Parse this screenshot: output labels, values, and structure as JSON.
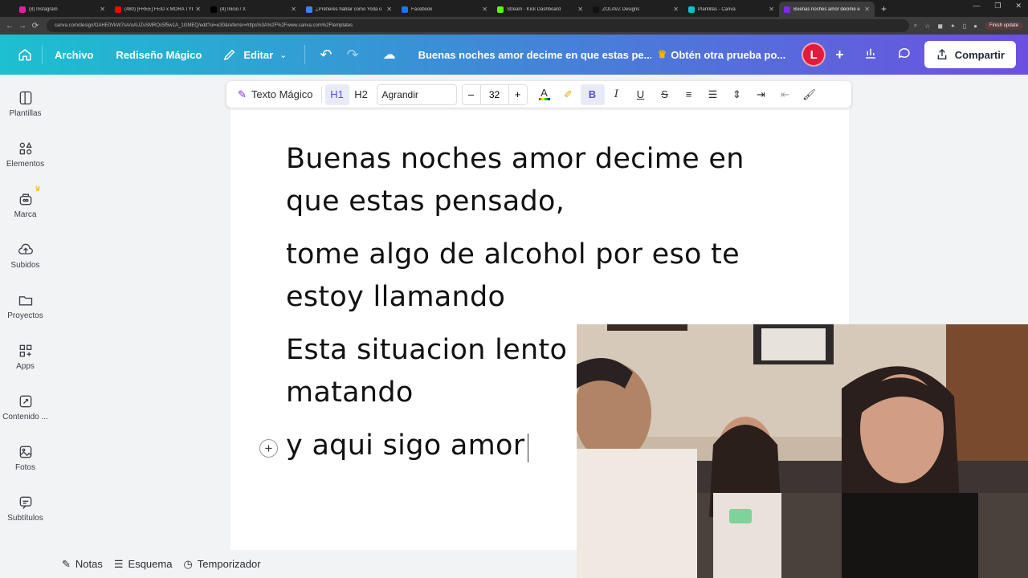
{
  "browser": {
    "tabs": [
      {
        "title": "(8) Instagram",
        "color": "#d6249f"
      },
      {
        "title": "(480) [FREE] FEID x MORA TYPE",
        "color": "#ff0000"
      },
      {
        "title": "(4) Inicio / X",
        "color": "#000000"
      },
      {
        "title": "¿Prefieres hablar como Yoda o",
        "color": "#3b82f6"
      },
      {
        "title": "Facebook",
        "color": "#1877f2"
      },
      {
        "title": "Stream - Kick Dashboard",
        "color": "#53fc18"
      },
      {
        "title": "ZOLAVZ Designs",
        "color": "#111111"
      },
      {
        "title": "Plantillas - Canva",
        "color": "#00c4cc"
      },
      {
        "title": "Buenas noches amor decime e",
        "color": "#7d2ae8",
        "active": true
      }
    ],
    "url": "canva.com/design/DAHE0VkW7sA/oAUZvSMROs5f5w1A_1GMEQ/edit?ui=e30&referrer=https%3A%2F%2Fwww.canva.com%2Ftemplates",
    "finish_update": "Finish update"
  },
  "header": {
    "file_menu": "Archivo",
    "magic_redesign": "Rediseño Mágico",
    "edit_menu": "Editar",
    "doc_title": "Buenas noches amor decime en que estas pe...",
    "trial": "Obtén otra prueba po...",
    "avatar_letter": "L",
    "share": "Compartir"
  },
  "sidebar": {
    "items": [
      {
        "label": "Plantillas",
        "icon": "templates-icon"
      },
      {
        "label": "Elementos",
        "icon": "elements-icon"
      },
      {
        "label": "Marca",
        "icon": "brand-icon"
      },
      {
        "label": "Subidos",
        "icon": "uploads-icon"
      },
      {
        "label": "Proyectos",
        "icon": "folder-icon"
      },
      {
        "label": "Apps",
        "icon": "apps-icon"
      },
      {
        "label": "Contenido ...",
        "icon": "magic-content-icon"
      },
      {
        "label": "Fotos",
        "icon": "photos-icon"
      },
      {
        "label": "Subtítulos",
        "icon": "captions-icon"
      }
    ]
  },
  "toolbar": {
    "magic_text": "Texto Mágico",
    "h1": "H1",
    "h2": "H2",
    "font": "Agrandir",
    "size": "32",
    "minus": "–",
    "plus": "+",
    "bold": "B",
    "italic": "I",
    "underline": "U",
    "strike": "S"
  },
  "document": {
    "paragraphs": [
      [
        "Buenas noches amor decime en",
        "que estas pensado,"
      ],
      [
        "tome algo de alcohol por eso te",
        "estoy llamando"
      ],
      [
        "Esta situacion lento",
        "matando"
      ],
      [
        "y aqui sigo amor"
      ]
    ]
  },
  "bottombar": {
    "notes": "Notas",
    "outline": "Esquema",
    "timer": "Temporizador"
  }
}
